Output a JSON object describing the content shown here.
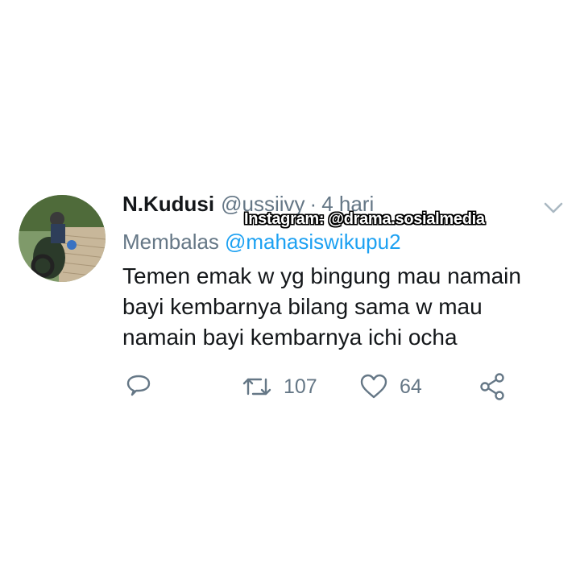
{
  "tweet": {
    "display_name": "N.Kudusi",
    "handle": "@ussiivy",
    "separator": "·",
    "time": "4 hari",
    "reply_label": "Membalas",
    "reply_mention": "@mahasiswikupu2",
    "text": "Temen emak w yg bingung mau namain\nbayi kembarnya bilang sama w mau\nnamain bayi kembarnya ichi ocha"
  },
  "watermark": {
    "text": "Instagram: @drama.sosialmedia"
  },
  "actions": {
    "reply_icon": "reply-icon",
    "retweet_icon": "retweet-icon",
    "retweet_count": "107",
    "like_icon": "heart-icon",
    "like_count": "64",
    "share_icon": "share-icon"
  },
  "colors": {
    "text_primary": "#14171a",
    "text_secondary": "#657786",
    "link": "#1da1f2"
  }
}
